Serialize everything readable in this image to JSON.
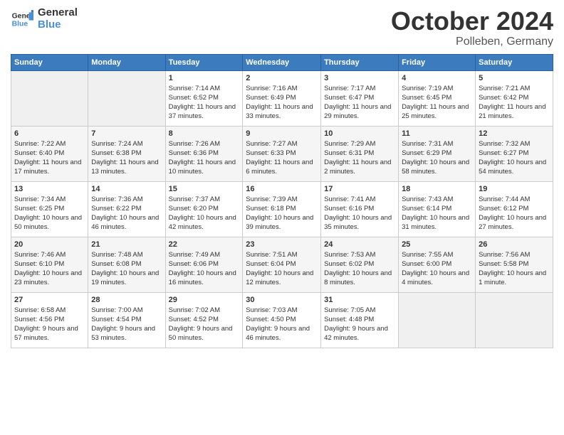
{
  "header": {
    "logo_line1": "General",
    "logo_line2": "Blue",
    "month": "October 2024",
    "location": "Polleben, Germany"
  },
  "days_of_week": [
    "Sunday",
    "Monday",
    "Tuesday",
    "Wednesday",
    "Thursday",
    "Friday",
    "Saturday"
  ],
  "weeks": [
    [
      {
        "day": "",
        "content": ""
      },
      {
        "day": "",
        "content": ""
      },
      {
        "day": "1",
        "content": "Sunrise: 7:14 AM\nSunset: 6:52 PM\nDaylight: 11 hours and 37 minutes."
      },
      {
        "day": "2",
        "content": "Sunrise: 7:16 AM\nSunset: 6:49 PM\nDaylight: 11 hours and 33 minutes."
      },
      {
        "day": "3",
        "content": "Sunrise: 7:17 AM\nSunset: 6:47 PM\nDaylight: 11 hours and 29 minutes."
      },
      {
        "day": "4",
        "content": "Sunrise: 7:19 AM\nSunset: 6:45 PM\nDaylight: 11 hours and 25 minutes."
      },
      {
        "day": "5",
        "content": "Sunrise: 7:21 AM\nSunset: 6:42 PM\nDaylight: 11 hours and 21 minutes."
      }
    ],
    [
      {
        "day": "6",
        "content": "Sunrise: 7:22 AM\nSunset: 6:40 PM\nDaylight: 11 hours and 17 minutes."
      },
      {
        "day": "7",
        "content": "Sunrise: 7:24 AM\nSunset: 6:38 PM\nDaylight: 11 hours and 13 minutes."
      },
      {
        "day": "8",
        "content": "Sunrise: 7:26 AM\nSunset: 6:36 PM\nDaylight: 11 hours and 10 minutes."
      },
      {
        "day": "9",
        "content": "Sunrise: 7:27 AM\nSunset: 6:33 PM\nDaylight: 11 hours and 6 minutes."
      },
      {
        "day": "10",
        "content": "Sunrise: 7:29 AM\nSunset: 6:31 PM\nDaylight: 11 hours and 2 minutes."
      },
      {
        "day": "11",
        "content": "Sunrise: 7:31 AM\nSunset: 6:29 PM\nDaylight: 10 hours and 58 minutes."
      },
      {
        "day": "12",
        "content": "Sunrise: 7:32 AM\nSunset: 6:27 PM\nDaylight: 10 hours and 54 minutes."
      }
    ],
    [
      {
        "day": "13",
        "content": "Sunrise: 7:34 AM\nSunset: 6:25 PM\nDaylight: 10 hours and 50 minutes."
      },
      {
        "day": "14",
        "content": "Sunrise: 7:36 AM\nSunset: 6:22 PM\nDaylight: 10 hours and 46 minutes."
      },
      {
        "day": "15",
        "content": "Sunrise: 7:37 AM\nSunset: 6:20 PM\nDaylight: 10 hours and 42 minutes."
      },
      {
        "day": "16",
        "content": "Sunrise: 7:39 AM\nSunset: 6:18 PM\nDaylight: 10 hours and 39 minutes."
      },
      {
        "day": "17",
        "content": "Sunrise: 7:41 AM\nSunset: 6:16 PM\nDaylight: 10 hours and 35 minutes."
      },
      {
        "day": "18",
        "content": "Sunrise: 7:43 AM\nSunset: 6:14 PM\nDaylight: 10 hours and 31 minutes."
      },
      {
        "day": "19",
        "content": "Sunrise: 7:44 AM\nSunset: 6:12 PM\nDaylight: 10 hours and 27 minutes."
      }
    ],
    [
      {
        "day": "20",
        "content": "Sunrise: 7:46 AM\nSunset: 6:10 PM\nDaylight: 10 hours and 23 minutes."
      },
      {
        "day": "21",
        "content": "Sunrise: 7:48 AM\nSunset: 6:08 PM\nDaylight: 10 hours and 19 minutes."
      },
      {
        "day": "22",
        "content": "Sunrise: 7:49 AM\nSunset: 6:06 PM\nDaylight: 10 hours and 16 minutes."
      },
      {
        "day": "23",
        "content": "Sunrise: 7:51 AM\nSunset: 6:04 PM\nDaylight: 10 hours and 12 minutes."
      },
      {
        "day": "24",
        "content": "Sunrise: 7:53 AM\nSunset: 6:02 PM\nDaylight: 10 hours and 8 minutes."
      },
      {
        "day": "25",
        "content": "Sunrise: 7:55 AM\nSunset: 6:00 PM\nDaylight: 10 hours and 4 minutes."
      },
      {
        "day": "26",
        "content": "Sunrise: 7:56 AM\nSunset: 5:58 PM\nDaylight: 10 hours and 1 minute."
      }
    ],
    [
      {
        "day": "27",
        "content": "Sunrise: 6:58 AM\nSunset: 4:56 PM\nDaylight: 9 hours and 57 minutes."
      },
      {
        "day": "28",
        "content": "Sunrise: 7:00 AM\nSunset: 4:54 PM\nDaylight: 9 hours and 53 minutes."
      },
      {
        "day": "29",
        "content": "Sunrise: 7:02 AM\nSunset: 4:52 PM\nDaylight: 9 hours and 50 minutes."
      },
      {
        "day": "30",
        "content": "Sunrise: 7:03 AM\nSunset: 4:50 PM\nDaylight: 9 hours and 46 minutes."
      },
      {
        "day": "31",
        "content": "Sunrise: 7:05 AM\nSunset: 4:48 PM\nDaylight: 9 hours and 42 minutes."
      },
      {
        "day": "",
        "content": ""
      },
      {
        "day": "",
        "content": ""
      }
    ]
  ]
}
